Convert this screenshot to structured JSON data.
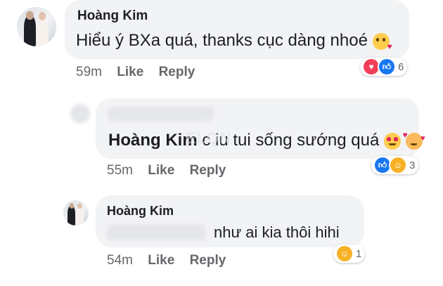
{
  "comments": [
    {
      "author": "Hoàng Kim",
      "text": "Hiểu ý BXa quá, thanks cục dàng nhoé",
      "emoji": "kissing-heart-emoji",
      "time": "59m",
      "like_label": "Like",
      "reply_label": "Reply",
      "reactions": [
        "love",
        "like"
      ],
      "reaction_count": "6"
    },
    {
      "author": "Hoàng Kim",
      "text": "c iu tui sống sướng quá",
      "emoji": [
        "heart-eyes-emoji",
        "smiling-face-with-hearts-emoji"
      ],
      "time": "55m",
      "like_label": "Like",
      "reply_label": "Reply",
      "reactions": [
        "like",
        "haha"
      ],
      "reaction_count": "3"
    },
    {
      "author": "Hoàng Kim",
      "text": "như ai kia thôi hihi",
      "time": "54m",
      "like_label": "Like",
      "reply_label": "Reply",
      "reactions": [
        "haha"
      ],
      "reaction_count": "1"
    }
  ],
  "colors": {
    "bubble": "#f2f3f5",
    "meta": "#65676b",
    "like_blue": "#1877f2",
    "love_red": "#f33e58",
    "haha_yellow": "#f7b125"
  }
}
